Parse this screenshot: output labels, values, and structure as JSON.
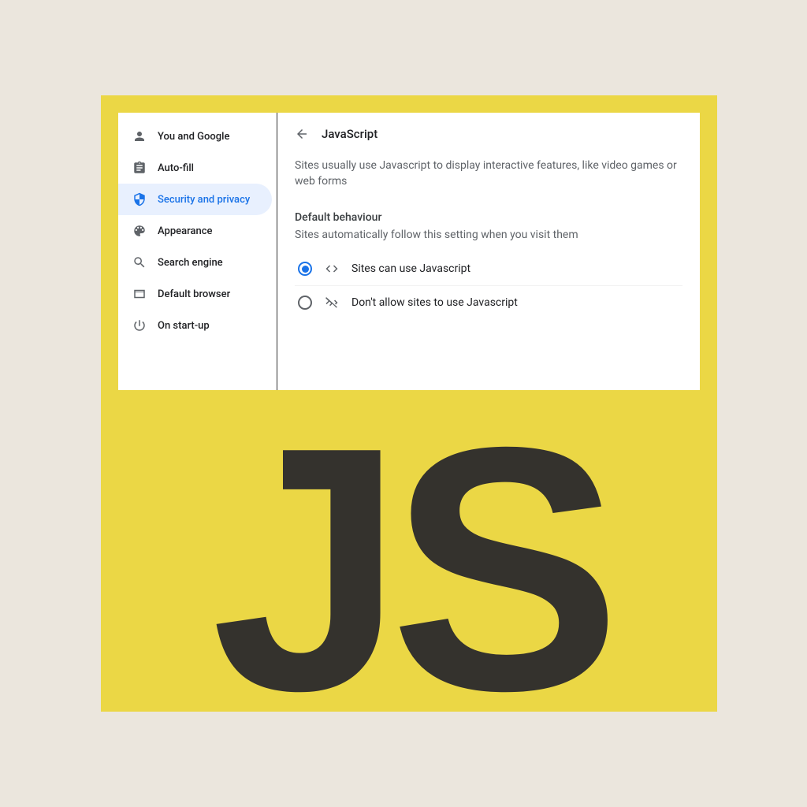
{
  "sidebar": {
    "items": [
      {
        "label": "You and Google",
        "icon": "person"
      },
      {
        "label": "Auto-fill",
        "icon": "clipboard"
      },
      {
        "label": "Security and privacy",
        "icon": "shield",
        "active": true
      },
      {
        "label": "Appearance",
        "icon": "palette"
      },
      {
        "label": "Search engine",
        "icon": "search"
      },
      {
        "label": "Default browser",
        "icon": "browser"
      },
      {
        "label": "On start-up",
        "icon": "power"
      }
    ]
  },
  "main": {
    "title": "JavaScript",
    "description": "Sites usually use Javascript to display interactive features, like video games or web forms",
    "section_title": "Default behaviour",
    "section_subtitle": "Sites automatically follow this setting when you visit them",
    "options": [
      {
        "label": "Sites can use Javascript",
        "checked": true,
        "icon": "code"
      },
      {
        "label": "Don't allow sites to use Javascript",
        "checked": false,
        "icon": "code-off"
      }
    ]
  },
  "logo": {
    "text": "JS"
  },
  "colors": {
    "accent": "#1a73e8",
    "yellow": "#ebd745",
    "bg": "#ebe6dd",
    "dark": "#34322d"
  }
}
